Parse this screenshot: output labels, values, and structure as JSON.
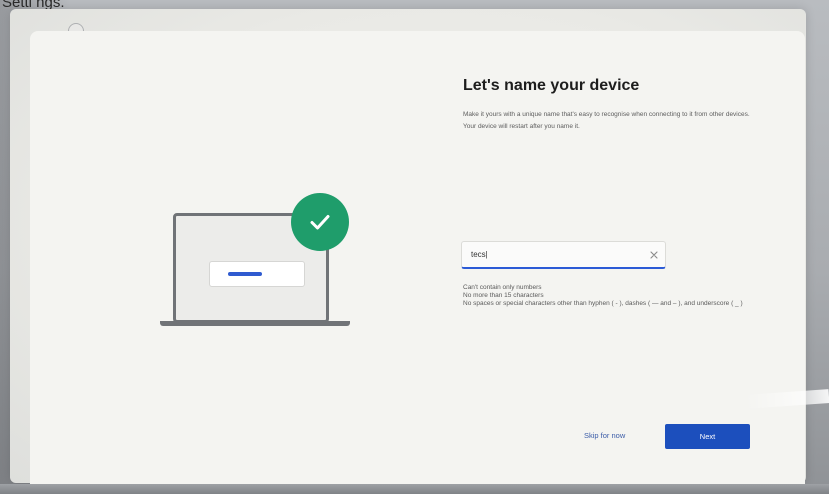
{
  "header": {
    "text": "Setti ngs."
  },
  "page": {
    "title": "Let's name your device",
    "description": "Make it yours with a unique name that's easy to recognise when connecting to it from other devices. Your device will restart after you name it."
  },
  "name_input": {
    "value": "tecs|"
  },
  "rules": [
    "Can't contain only numbers",
    "No more than 15 characters",
    "No spaces or special characters other than hyphen ( - ), dashes ( — and – ), and underscore ( _ )"
  ],
  "actions": {
    "skip_label": "Skip for now",
    "next_label": "Next"
  },
  "colors": {
    "accent": "#1c4fbd",
    "badge": "#1f9d6b",
    "input_underline": "#2c5bd6"
  },
  "icons": {
    "badge": "checkmark-icon",
    "clear": "close-icon",
    "illustration": "laptop-icon"
  }
}
